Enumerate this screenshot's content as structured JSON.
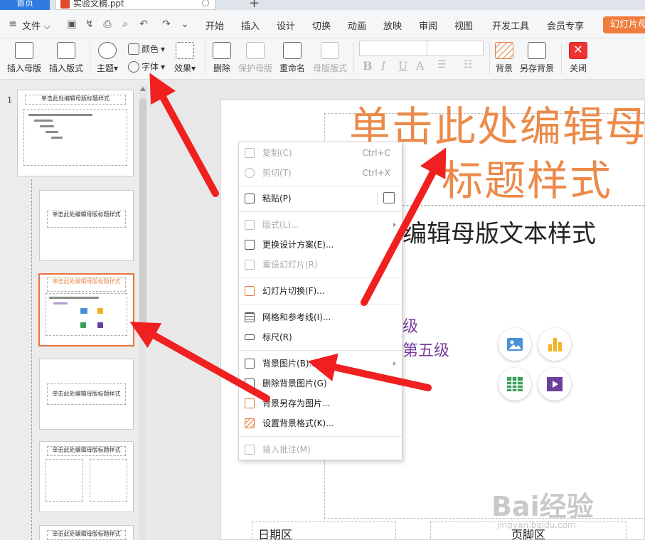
{
  "tabs": {
    "home": "首页",
    "document": "实验文稿.ppt"
  },
  "menu": {
    "file": "文件",
    "items": [
      "开始",
      "插入",
      "设计",
      "切换",
      "动画",
      "放映",
      "审阅",
      "视图",
      "开发工具",
      "会员专享"
    ],
    "slide_master_tab": "幻灯片母"
  },
  "ribbon": {
    "insert_master": "插入母版",
    "insert_layout": "插入版式",
    "theme": "主题",
    "color": "颜色",
    "font": "字体",
    "effect": "效果",
    "delete": "删除",
    "protect_master": "保护母版",
    "rename": "重命名",
    "master_layout": "母版版式",
    "background": "背景",
    "save_background": "另存背景",
    "close": "关闭",
    "format": {
      "bold": "B",
      "italic": "I",
      "underline": "U",
      "font_color": "A"
    }
  },
  "panel": {
    "slide_number": "1",
    "thumb_titles": [
      "单击此处编辑母版标题样式",
      "单击此处编辑母版标题样式",
      "单击此处编辑母版标题样式",
      "单击此处编辑母版标题样式",
      "单击此处编辑母版标题样式",
      "单击此处编辑母版标题样式"
    ]
  },
  "slide": {
    "title_line1": "单击此处编辑母",
    "title_line2": "标题样式",
    "body_text": "编辑母版文本样式",
    "level4": "级",
    "level5": "第五级",
    "date_area": "日期区",
    "footer_area": "页脚区"
  },
  "watermark": {
    "logo": "Bai经验",
    "url": "jingyan.baidu.com"
  },
  "context_menu": {
    "copy": "复制(C)",
    "copy_key": "Ctrl+C",
    "cut": "剪切(T)",
    "cut_key": "Ctrl+X",
    "paste": "粘贴(P)",
    "layout": "版式(L)...",
    "change_design": "更换设计方案(E)...",
    "reset_slide": "重设幻灯片(R)",
    "slide_transition": "幻灯片切换(F)...",
    "grid_guides": "网格和参考线(I)...",
    "ruler": "标尺(R)",
    "background_picture": "背景图片(B)...",
    "delete_background_picture": "删除背景图片(G)",
    "save_background_as_picture": "背景另存为图片...",
    "format_background": "设置背景格式(K)...",
    "insert_comment": "插入批注(M)"
  },
  "colors": {
    "accent_orange": "#ec8a4a",
    "arrow_red": "#f02020",
    "tab_blue": "#2f7be0",
    "level_purple": "#7a3d9e"
  }
}
